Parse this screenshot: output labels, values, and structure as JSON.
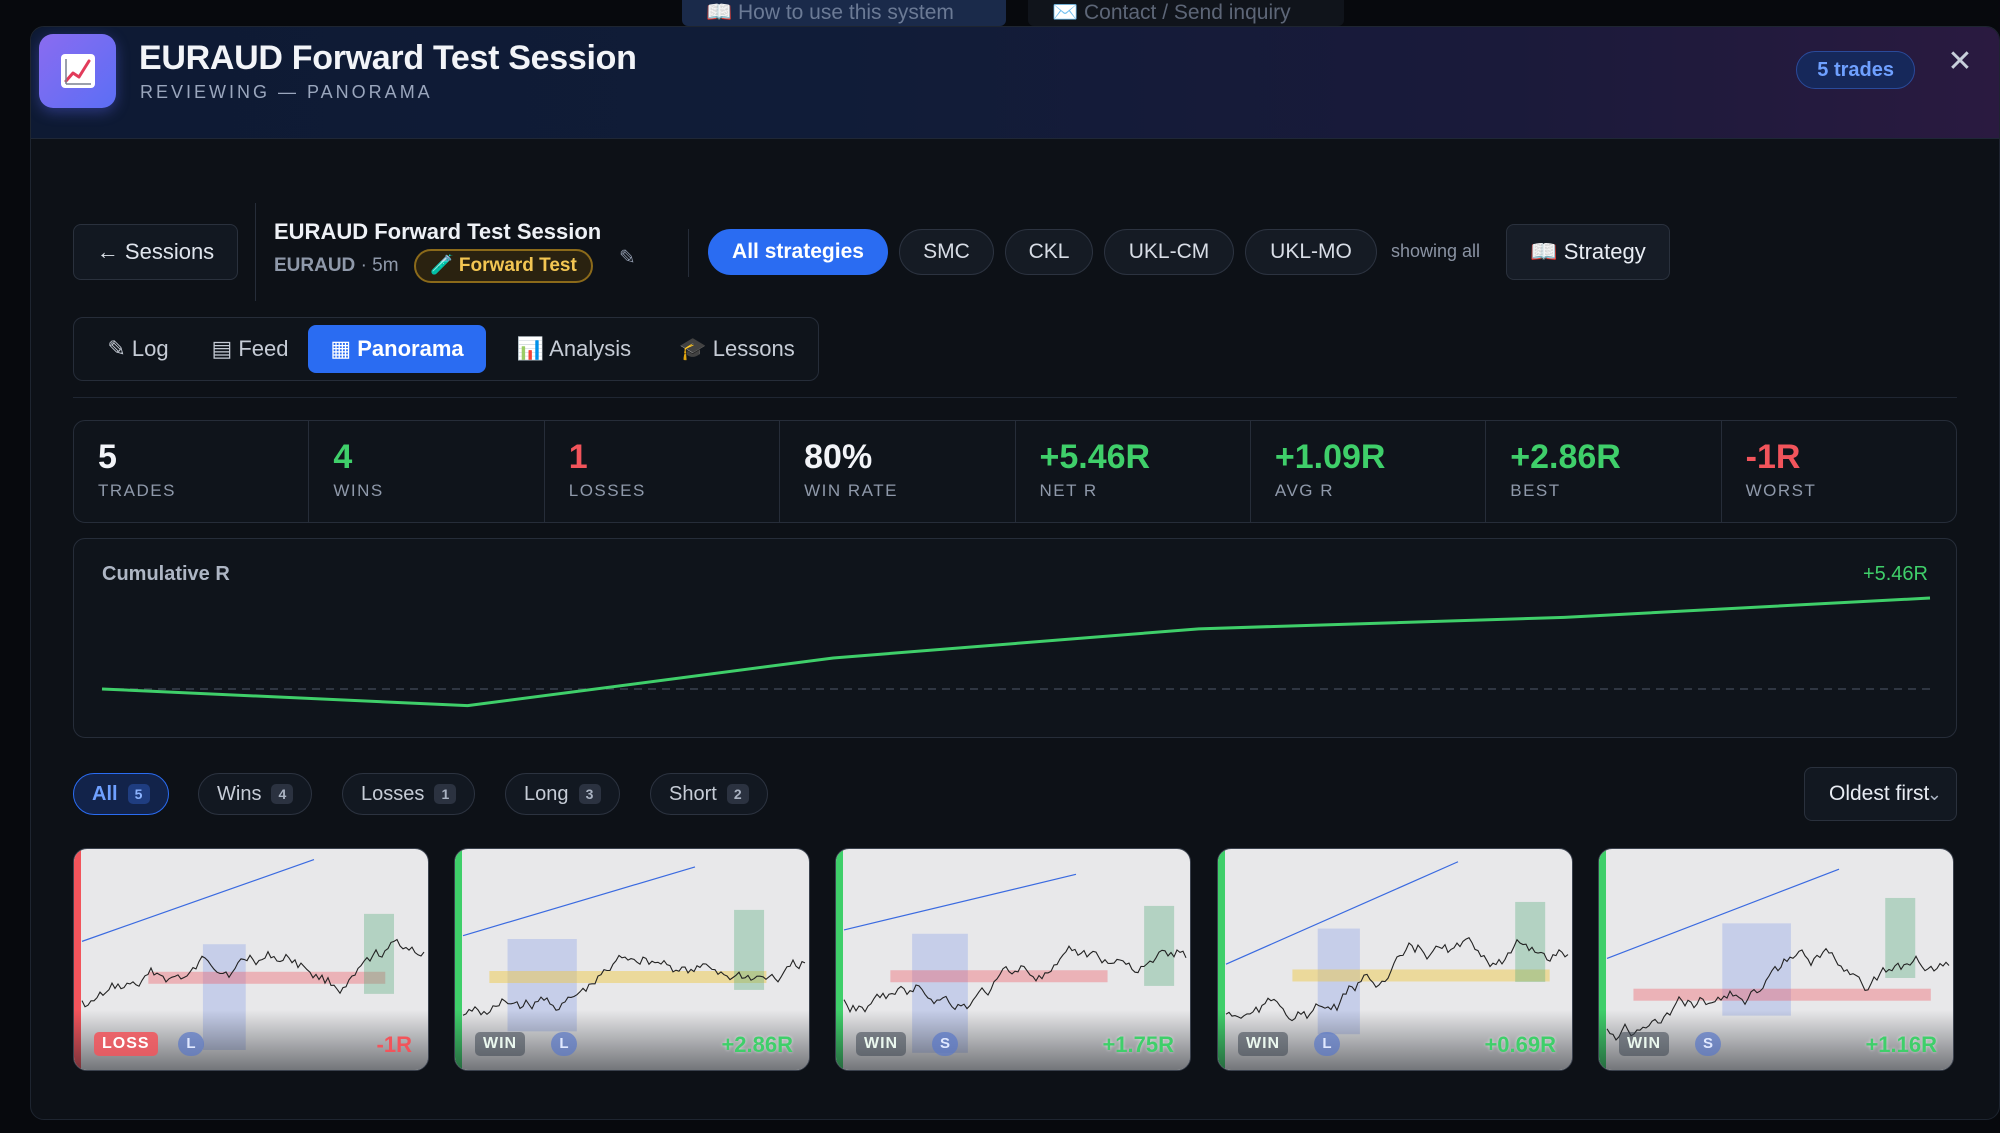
{
  "background": {
    "help_link": "📖 How to use this system",
    "contact_link": "✉️ Contact / Send inquiry"
  },
  "header": {
    "icon": "chart-icon",
    "title": "EURAUD Forward Test Session",
    "subtitle": "REVIEWING — PANORAMA",
    "trades_badge": "5 trades",
    "close": "✕"
  },
  "toolbar": {
    "back_label": "← Sessions",
    "session_name": "EURAUD Forward Test Session",
    "symbol": "EURAUD",
    "timeframe": "· 5m",
    "mode_badge": "🧪 Forward Test",
    "edit_icon": "✎",
    "strategies": [
      "All strategies",
      "SMC",
      "CKL",
      "UKL-CM",
      "UKL-MO"
    ],
    "active_strategy": "All strategies",
    "showing_text": "showing all",
    "strategy_button": "📖 Strategy"
  },
  "tabs": [
    {
      "label": "✎ Log"
    },
    {
      "label": "▤ Feed"
    },
    {
      "label": "▦ Panorama"
    },
    {
      "label": "📊 Analysis"
    },
    {
      "label": "🎓 Lessons"
    }
  ],
  "active_tab": "Panorama",
  "stats": [
    {
      "value": "5",
      "label": "TRADES"
    },
    {
      "value": "4",
      "label": "WINS"
    },
    {
      "value": "1",
      "label": "LOSSES"
    },
    {
      "value": "80%",
      "label": "WIN RATE"
    },
    {
      "value": "+5.46R",
      "label": "NET R"
    },
    {
      "value": "+1.09R",
      "label": "AVG R"
    },
    {
      "value": "+2.86R",
      "label": "BEST"
    },
    {
      "value": "-1R",
      "label": "WORST"
    }
  ],
  "cumulative": {
    "title": "Cumulative R",
    "end_label": "+5.46R"
  },
  "chart_data": {
    "type": "line",
    "x": [
      0,
      1,
      2,
      3,
      4,
      5
    ],
    "series": [
      {
        "values": [
          0,
          -1,
          1.86,
          3.61,
          4.3,
          5.46
        ]
      }
    ],
    "baseline": 0
  },
  "filters": [
    {
      "label": "All",
      "count": "5"
    },
    {
      "label": "Wins",
      "count": "4"
    },
    {
      "label": "Losses",
      "count": "1"
    },
    {
      "label": "Long",
      "count": "3"
    },
    {
      "label": "Short",
      "count": "2"
    }
  ],
  "active_filter": "All",
  "sort": {
    "selected": "Oldest first",
    "icon": "chevron-down-icon"
  },
  "trades": [
    {
      "result": "LOSS",
      "direction": "L",
      "r": "-1R"
    },
    {
      "result": "WIN",
      "direction": "L",
      "r": "+2.86R"
    },
    {
      "result": "WIN",
      "direction": "S",
      "r": "+1.75R"
    },
    {
      "result": "WIN",
      "direction": "L",
      "r": "+0.69R"
    },
    {
      "result": "WIN",
      "direction": "S",
      "r": "+1.16R"
    }
  ],
  "colors": {
    "accent": "#2a6cf2",
    "win": "#3fcf6a",
    "loss": "#f2545b",
    "badge_gold": "#f3c653"
  }
}
